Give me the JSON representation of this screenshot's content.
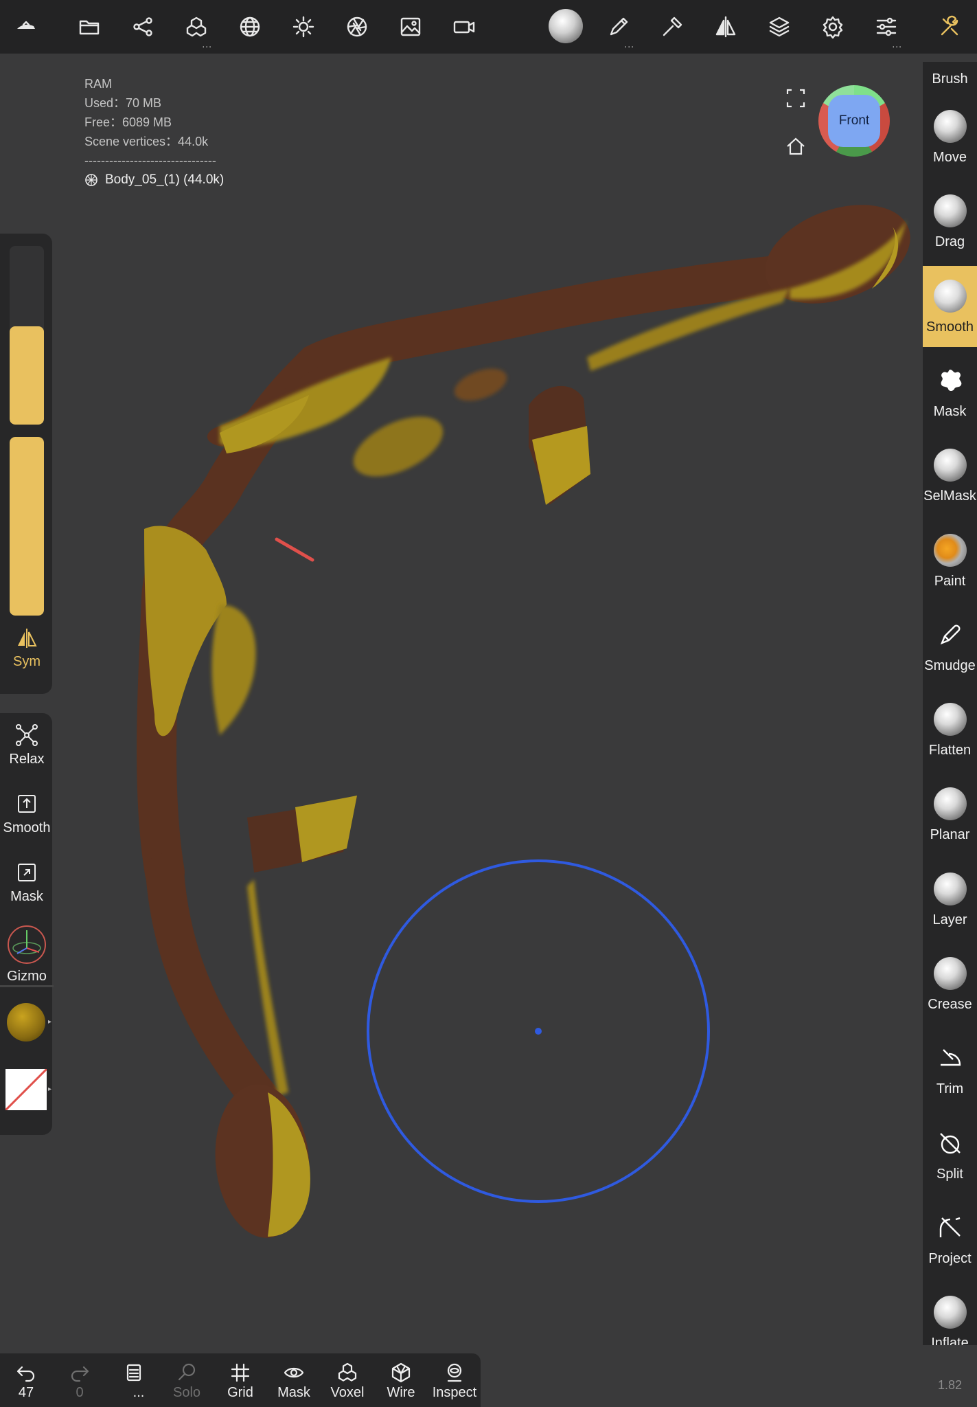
{
  "toolbar": {
    "icons": [
      "logo-icon",
      "folder-icon",
      "share-icon",
      "scene-icon",
      "sphere-icon",
      "light-icon",
      "aperture-icon",
      "image-icon",
      "camera-icon",
      "brush-preview-icon",
      "pencil-icon",
      "hammer-icon",
      "symmetry-icon",
      "layers-icon",
      "settings-icon",
      "sliders-icon",
      "tools-icon"
    ],
    "more_indicator": "..."
  },
  "stats": {
    "ram_label": "RAM",
    "used": "Used：70 MB",
    "free": "Free：6089 MB",
    "vertices": "Scene vertices：44.0k",
    "separator": "--------------------------------",
    "object": "Body_05_(1) (44.0k)"
  },
  "viewcube": {
    "face": "Front"
  },
  "left_panel": {
    "radius_level": 0.55,
    "intensity_level": 1.0,
    "sym_label": "Sym",
    "tools": [
      {
        "label": "Relax"
      },
      {
        "label": "Smooth"
      },
      {
        "label": "Mask"
      },
      {
        "label": "Gizmo"
      }
    ]
  },
  "right_panel": {
    "header": "Brush",
    "brushes": [
      {
        "label": "Move"
      },
      {
        "label": "Drag"
      },
      {
        "label": "Smooth",
        "active": true
      },
      {
        "label": "Mask"
      },
      {
        "label": "SelMask"
      },
      {
        "label": "Paint"
      },
      {
        "label": "Smudge"
      },
      {
        "label": "Flatten"
      },
      {
        "label": "Planar"
      },
      {
        "label": "Layer"
      },
      {
        "label": "Crease"
      },
      {
        "label": "Trim"
      },
      {
        "label": "Split"
      },
      {
        "label": "Project"
      },
      {
        "label": "Inflate"
      }
    ]
  },
  "bottom_bar": {
    "undo_count": "47",
    "redo_count": "0",
    "more": "...",
    "items": [
      "Solo",
      "Grid",
      "Mask",
      "Voxel",
      "Wire",
      "Inspect"
    ]
  },
  "version": "1.82",
  "colors": {
    "accent": "#e9c15f",
    "cursor": "#2f5ae0",
    "background": "#3a3a3b"
  }
}
